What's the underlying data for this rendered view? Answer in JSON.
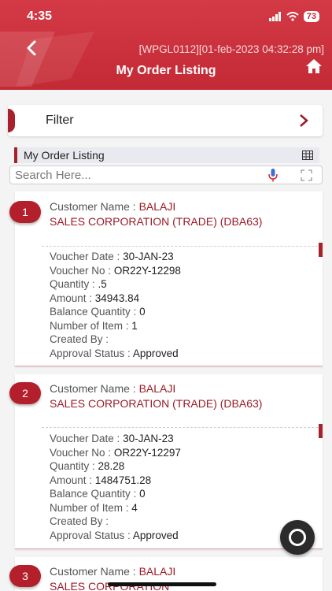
{
  "status_bar": {
    "time": "4:35",
    "battery": "73"
  },
  "header": {
    "info": "[WPGL0112][01-feb-2023 04:32:28 pm]",
    "title": "My Order Listing"
  },
  "filter": {
    "label": "Filter"
  },
  "listing": {
    "label": "My Order Listing"
  },
  "search": {
    "placeholder": "Search Here..."
  },
  "labels": {
    "customer_name": "Customer Name : ",
    "voucher_date": "Voucher Date : ",
    "voucher_no": "Voucher No : ",
    "quantity": "Quantity : ",
    "amount": "Amount : ",
    "balance_quantity": "Balance Quantity : ",
    "number_of_item": "Number of Item : ",
    "created_by": "Created By : ",
    "approval_status": "Approval Status : "
  },
  "orders": [
    {
      "index": "1",
      "name_first": "BALAJI",
      "name_rest": "SALES CORPORATION (TRADE) (DBA63)",
      "voucher_date": "30-JAN-23",
      "voucher_no": "OR22Y-12298",
      "quantity": ".5",
      "amount": "34943.84",
      "balance_quantity": "0",
      "number_of_item": "1",
      "created_by": "",
      "approval_status": "Approved"
    },
    {
      "index": "2",
      "name_first": "BALAJI",
      "name_rest": "SALES CORPORATION (TRADE) (DBA63)",
      "voucher_date": "30-JAN-23",
      "voucher_no": "OR22Y-12297",
      "quantity": "28.28",
      "amount": "1484751.28",
      "balance_quantity": "0",
      "number_of_item": "4",
      "created_by": "",
      "approval_status": "Approved"
    },
    {
      "index": "3",
      "name_first": "BALAJI",
      "name_rest": "SALES CORPORATION"
    }
  ]
}
